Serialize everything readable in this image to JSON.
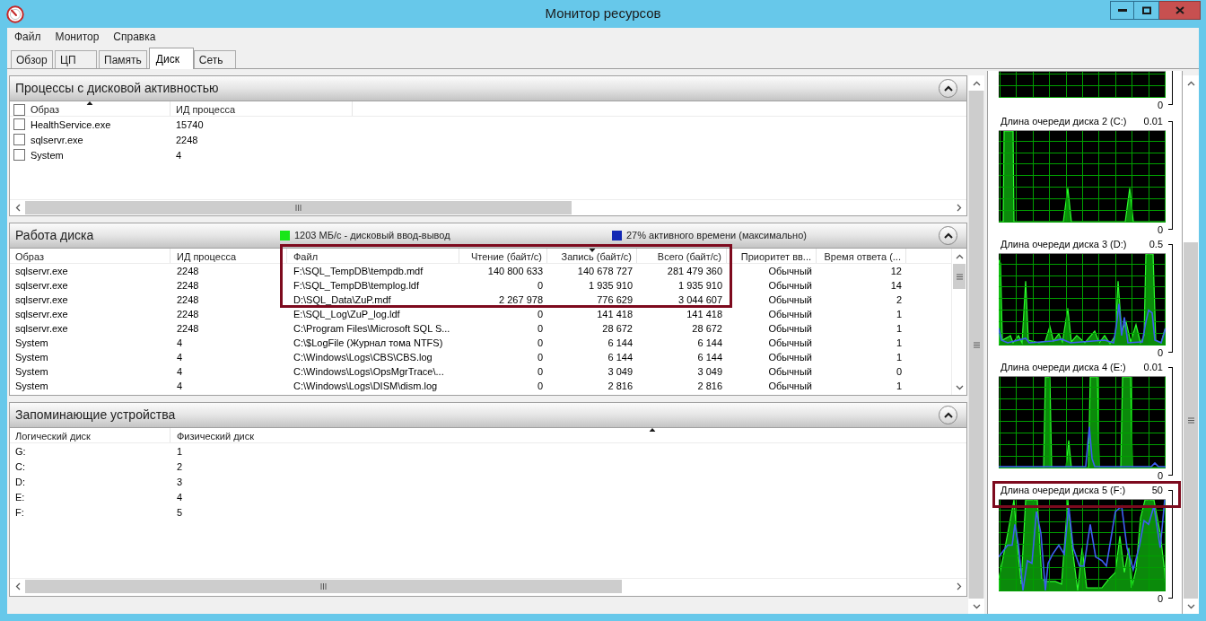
{
  "window": {
    "title": "Монитор ресурсов"
  },
  "menu": [
    {
      "label": "Файл"
    },
    {
      "label": "Монитор"
    },
    {
      "label": "Справка"
    }
  ],
  "tabs": [
    {
      "label": "Обзор",
      "selected": false
    },
    {
      "label": "ЦП",
      "selected": false
    },
    {
      "label": "Память",
      "selected": false
    },
    {
      "label": "Диск",
      "selected": true
    },
    {
      "label": "Сеть",
      "selected": false
    }
  ],
  "processes": {
    "title": "Процессы с дисковой активностью",
    "header_checked": false,
    "columns": [
      {
        "label": "Образ",
        "sorted": true,
        "descending": false
      },
      {
        "label": "ИД процесса",
        "sorted": false
      }
    ],
    "rows": [
      {
        "checked": false,
        "cells": [
          "HealthService.exe",
          "15740"
        ]
      },
      {
        "checked": false,
        "cells": [
          "sqlservr.exe",
          "2248"
        ]
      },
      {
        "checked": false,
        "cells": [
          "System",
          "4"
        ]
      }
    ]
  },
  "disk_activity": {
    "title": "Работа диска",
    "legend": [
      {
        "label": "1203 МБ/с - дисковый ввод-вывод",
        "color": "#19e619"
      },
      {
        "label": "27% активного времени (максимально)",
        "color": "#1228b4"
      }
    ],
    "columns": [
      {
        "label": "Образ",
        "sorted": false
      },
      {
        "label": "ИД процесса",
        "sorted": false
      },
      {
        "label": "Файл",
        "sorted": false
      },
      {
        "label": "Чтение (байт/с)",
        "sorted": false
      },
      {
        "label": "Запись (байт/с)",
        "sorted": true,
        "descending": true
      },
      {
        "label": "Всего (байт/с)",
        "sorted": false
      },
      {
        "label": "Приоритет вв...",
        "sorted": false
      },
      {
        "label": "Время ответа (...",
        "sorted": false
      }
    ],
    "rows": [
      {
        "highlighted": true,
        "cells": [
          "sqlservr.exe",
          "2248",
          "F:\\SQL_TempDB\\tempdb.mdf",
          "140 800 633",
          "140 678 727",
          "281 479 360",
          "Обычный",
          "12"
        ]
      },
      {
        "highlighted": true,
        "cells": [
          "sqlservr.exe",
          "2248",
          "F:\\SQL_TempDB\\templog.ldf",
          "0",
          "1 935 910",
          "1 935 910",
          "Обычный",
          "14"
        ]
      },
      {
        "highlighted": true,
        "cells": [
          "sqlservr.exe",
          "2248",
          "D:\\SQL_Data\\ZuP.mdf",
          "2 267 978",
          "776 629",
          "3 044 607",
          "Обычный",
          "2"
        ]
      },
      {
        "highlighted": false,
        "cells": [
          "sqlservr.exe",
          "2248",
          "E:\\SQL_Log\\ZuP_log.ldf",
          "0",
          "141 418",
          "141 418",
          "Обычный",
          "1"
        ]
      },
      {
        "highlighted": false,
        "cells": [
          "sqlservr.exe",
          "2248",
          "C:\\Program Files\\Microsoft SQL S...",
          "0",
          "28 672",
          "28 672",
          "Обычный",
          "1"
        ]
      },
      {
        "highlighted": false,
        "cells": [
          "System",
          "4",
          "C:\\$LogFile (Журнал тома NTFS)",
          "0",
          "6 144",
          "6 144",
          "Обычный",
          "1"
        ]
      },
      {
        "highlighted": false,
        "cells": [
          "System",
          "4",
          "C:\\Windows\\Logs\\CBS\\CBS.log",
          "0",
          "6 144",
          "6 144",
          "Обычный",
          "1"
        ]
      },
      {
        "highlighted": false,
        "cells": [
          "System",
          "4",
          "C:\\Windows\\Logs\\OpsMgrTrace\\...",
          "0",
          "3 049",
          "3 049",
          "Обычный",
          "0"
        ]
      },
      {
        "highlighted": false,
        "cells": [
          "System",
          "4",
          "C:\\Windows\\Logs\\DISM\\dism.log",
          "0",
          "2 816",
          "2 816",
          "Обычный",
          "1"
        ]
      }
    ]
  },
  "storage": {
    "title": "Запоминающие устройства",
    "columns": [
      {
        "label": "Логический диск",
        "sorted": false
      },
      {
        "label": "Физический диск",
        "sorted": true,
        "descending": false
      }
    ],
    "rows": [
      [
        "G:",
        "1"
      ],
      [
        "C:",
        "2"
      ],
      [
        "D:",
        "3"
      ],
      [
        "E:",
        "4"
      ],
      [
        "F:",
        "5"
      ]
    ]
  },
  "graphs": [
    {
      "min_label": "0",
      "highlighted": false
    },
    {
      "title": "Длина очереди диска 2 (C:)",
      "max_label": "0.01",
      "min_label": "0",
      "highlighted": false
    },
    {
      "title": "Длина очереди диска 3 (D:)",
      "max_label": "0.5",
      "min_label": "0",
      "highlighted": false
    },
    {
      "title": "Длина очереди диска 4 (E:)",
      "max_label": "0.01",
      "min_label": "0",
      "highlighted": false
    },
    {
      "title": "Длина очереди диска 5 (F:)",
      "max_label": "50",
      "min_label": "0",
      "highlighted": true
    }
  ]
}
